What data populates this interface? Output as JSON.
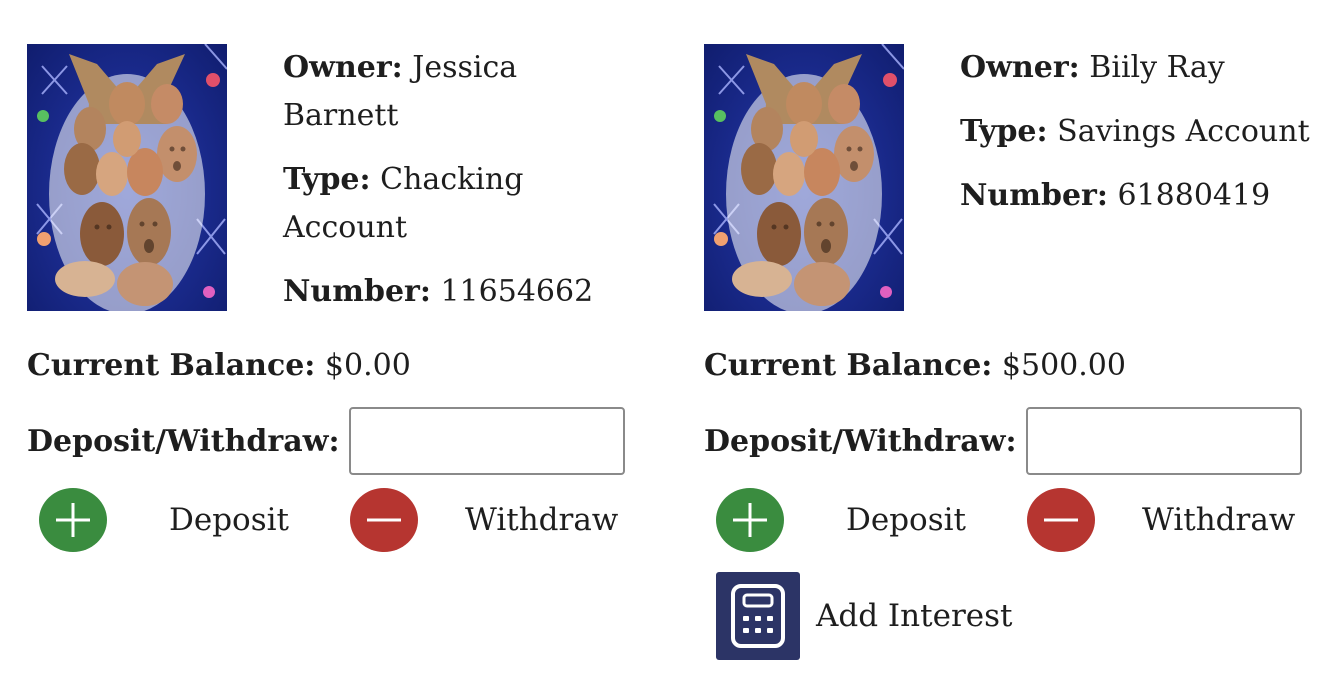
{
  "accounts": [
    {
      "owner_label": "Owner:",
      "owner": "Jessica Barnett",
      "type_label": "Type:",
      "type": "Chacking Account",
      "number_label": "Number:",
      "number": "11654662",
      "balance_label": "Current Balance:",
      "balance": "$0.00",
      "dw_label": "Deposit/Withdraw:",
      "amount_value": "",
      "deposit_label": "Deposit",
      "withdraw_label": "Withdraw"
    },
    {
      "owner_label": "Owner:",
      "owner": "Biily Ray",
      "type_label": "Type:",
      "type": "Savings Account",
      "number_label": "Number:",
      "number": "61880419",
      "balance_label": "Current Balance:",
      "balance": "$500.00",
      "dw_label": "Deposit/Withdraw:",
      "amount_value": "",
      "deposit_label": "Deposit",
      "withdraw_label": "Withdraw",
      "interest_label": "Add Interest"
    }
  ],
  "icons": {
    "deposit": "plus-icon",
    "withdraw": "minus-icon",
    "interest": "calculator-icon"
  },
  "colors": {
    "deposit": "#3a8c3f",
    "withdraw": "#b63530",
    "interest": "#2c3466"
  }
}
